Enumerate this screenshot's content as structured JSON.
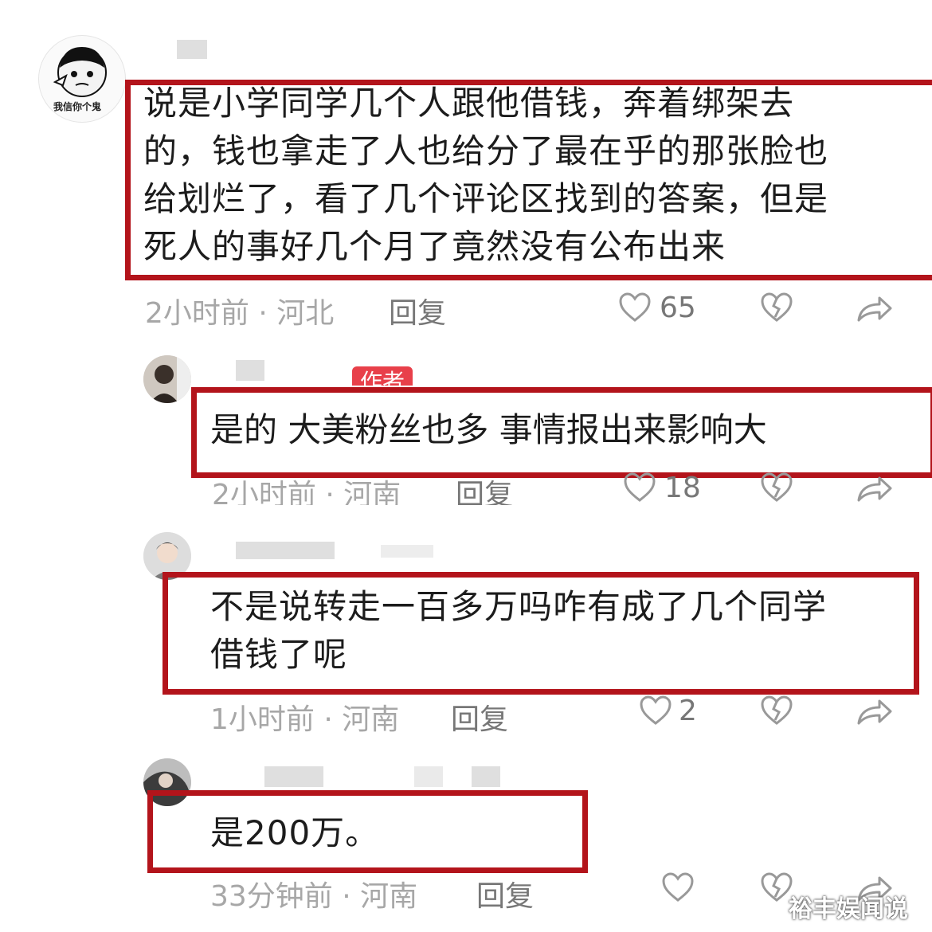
{
  "comments": [
    {
      "text": "说是小学同学几个人跟他借钱，奔着绑架去\n的，钱也拿走了人也给分了最在乎的那张脸也\n给划烂了，看了几个评论区找到的答案，但是\n死人的事好几个月了竟然没有公布出来",
      "meta": "2小时前 · 河北",
      "reply": "回复",
      "likes": "65",
      "avatar_caption": "我信你个鬼"
    },
    {
      "badge": "作者",
      "text": "是的  大美粉丝也多  事情报出来影响大",
      "meta": "2小时前 · 河南",
      "reply": "回复",
      "likes": "18"
    },
    {
      "text": "不是说转走一百多万吗咋有成了几个同学\n借钱了呢",
      "meta": "1小时前 · 河南",
      "reply": "回复",
      "likes": "2"
    },
    {
      "text": "是200万。",
      "meta": "33分钟前 · 河南",
      "reply": "回复",
      "likes": ""
    }
  ],
  "watermark": "裕丰娱闻说",
  "colors": {
    "highlight_box": "#b3141b",
    "badge": "#e8404a",
    "meta_text": "#a7a7a7"
  },
  "icons": [
    "heart-outline-icon",
    "broken-heart-icon",
    "share-arrow-icon"
  ]
}
